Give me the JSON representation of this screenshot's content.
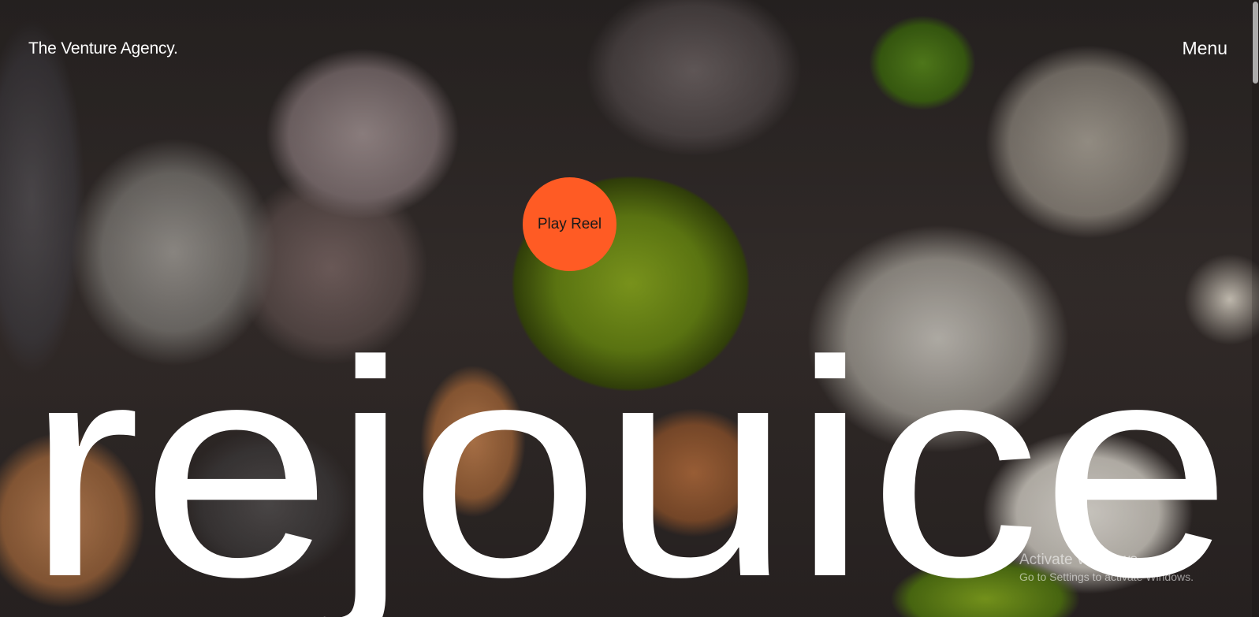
{
  "header": {
    "brand": "The Venture Agency.",
    "menu_label": "Menu"
  },
  "hero": {
    "play_reel_label": "Play Reel",
    "wordmark": "rejouice"
  },
  "windows_watermark": {
    "title": "Activate Windows",
    "subtitle": "Go to Settings to activate Windows."
  },
  "colors": {
    "accent": "#ff5b24",
    "text": "#ffffff"
  }
}
